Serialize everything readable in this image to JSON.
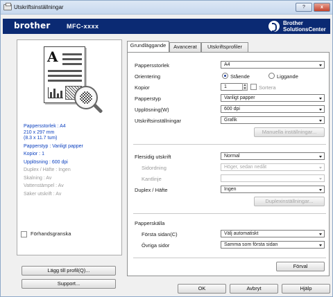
{
  "window": {
    "title": "Utskriftsinställningar",
    "help": "?",
    "close": "x"
  },
  "header": {
    "brand": "brother",
    "model": "MFC-xxxx",
    "solutions_line1": "Brother",
    "solutions_line2": "SolutionsCenter"
  },
  "summary": {
    "paper_size": "Pappersstorlek : A4",
    "dims1": "210 x 297 mm",
    "dims2": "(8.3 x 11.7 tum)",
    "media": "Papperstyp : Vanligt papper",
    "copies": "Kopior : 1",
    "resolution": "Upplösning : 600 dpi",
    "duplex": "Duplex / Häfte : Ingen",
    "scaling": "Skalning : Av",
    "watermark": "Vattenstämpel : Av",
    "secure": "Säker utskrift : Av"
  },
  "left_controls": {
    "preview": "Förhandsgranska",
    "add_profile": "Lägg till profil(Q)...",
    "support": "Support..."
  },
  "tabs": [
    "Grundläggande",
    "Avancerat",
    "Utskriftsprofiler"
  ],
  "form": {
    "paper_size_label": "Pappersstorlek",
    "paper_size_value": "A4",
    "orientation_label": "Orientering",
    "portrait": "Stående",
    "landscape": "Liggande",
    "copies_label": "Kopior",
    "copies_value": "1",
    "collate": "Sortera",
    "media_label": "Papperstyp",
    "media_value": "Vanligt papper",
    "resolution_label": "Upplösning(W)",
    "resolution_value": "600 dpi",
    "print_settings_label": "Utskriftsinställningar",
    "print_settings_value": "Grafik",
    "manual_settings": "Manuella inställningar...",
    "multiple_page_label": "Flersidig utskrift",
    "multiple_page_value": "Normal",
    "page_order_label": "Sidordning",
    "page_order_value": "Höger, sedan nedåt",
    "border_label": "Kantlinje",
    "border_value": "",
    "duplex_label": "Duplex / Häfte",
    "duplex_value": "Ingen",
    "duplex_settings": "Duplexinställningar...",
    "paper_source_label": "Papperskälla",
    "first_page_label": "Första sidan(C)",
    "first_page_value": "Välj automatiskt",
    "other_pages_label": "Övriga sidor",
    "other_pages_value": "Samma som första sidan",
    "default": "Förval"
  },
  "dialog_buttons": {
    "ok": "OK",
    "cancel": "Avbryt",
    "help": "Hjälp"
  }
}
